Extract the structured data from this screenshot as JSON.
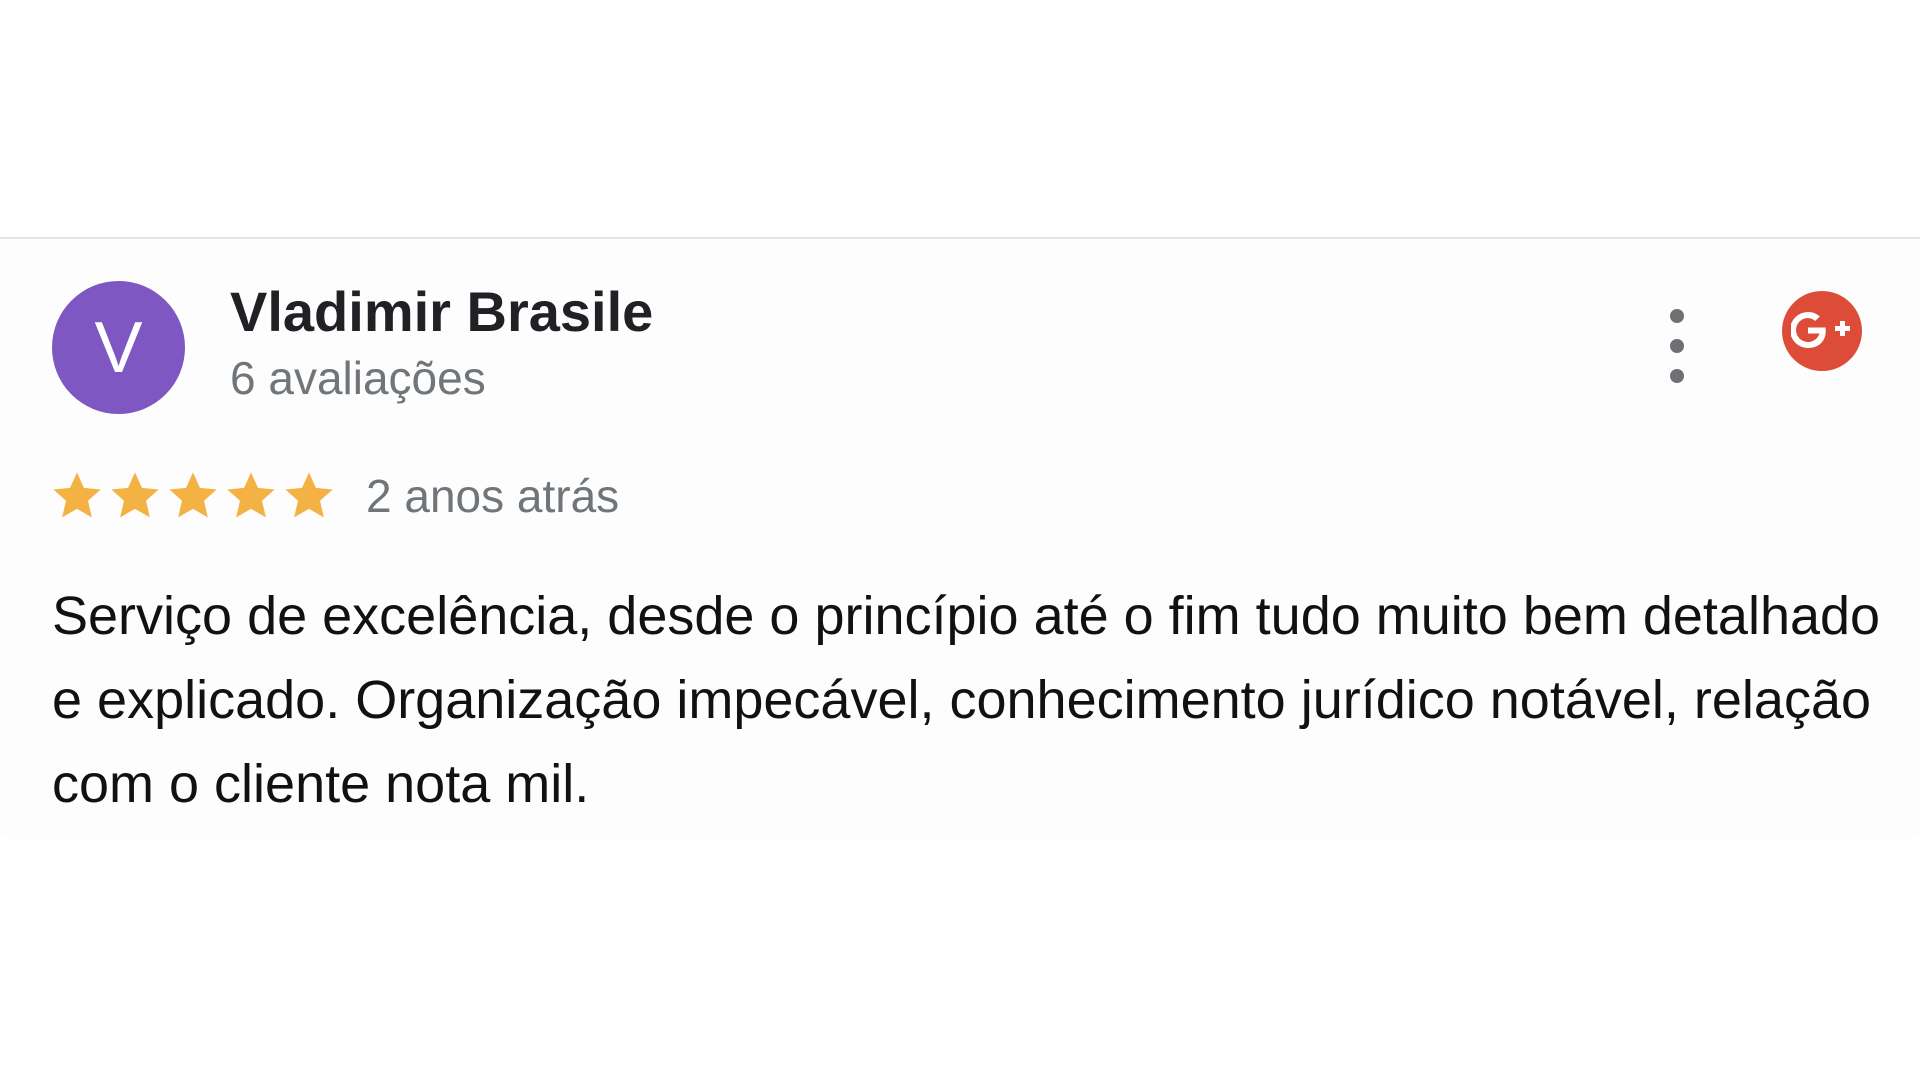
{
  "review": {
    "avatar_initial": "V",
    "avatar_color": "#7e57c2",
    "reviewer_name": "Vladimir Brasile",
    "review_count": "6 avaliações",
    "rating": 5,
    "rating_max": 5,
    "star_color": "#f4b245",
    "time_ago": "2 anos atrás",
    "text": "Serviço de excelência, desde o princípio até o fim tudo muito bem detalhado e explicado. Organização impecável, conhecimento jurídico notável, relação com o cliente nota mil.",
    "more_icon": "more-vertical-icon",
    "source_icon": "google-plus-icon",
    "source_color": "#dd4b39"
  }
}
